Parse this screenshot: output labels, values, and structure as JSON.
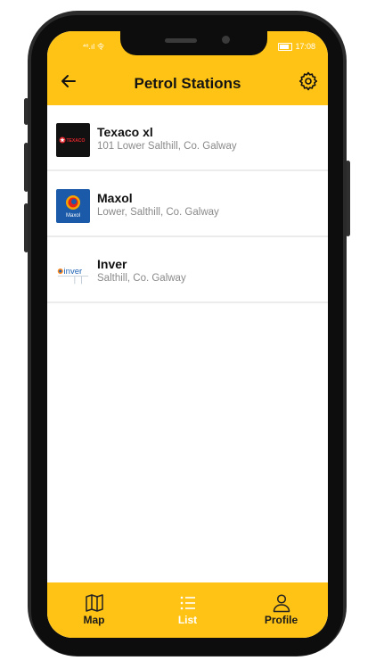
{
  "status": {
    "left": "⁴⁶.ıl 令",
    "time": "17:08"
  },
  "header": {
    "title": "Petrol Stations",
    "back_icon": "arrow-left-icon",
    "settings_icon": "gear-icon"
  },
  "stations": [
    {
      "name": "Texaco xl",
      "address": "101 Lower Salthill, Co. Galway",
      "logo": "texaco-logo",
      "logo_text": "TEXACO"
    },
    {
      "name": "Maxol",
      "address": "Lower, Salthill, Co. Galway",
      "logo": "maxol-logo",
      "logo_text": "Maxol"
    },
    {
      "name": "Inver",
      "address": "Salthill, Co. Galway",
      "logo": "inver-logo",
      "logo_text": "inver"
    }
  ],
  "nav": {
    "items": [
      {
        "label": "Map",
        "icon": "map-icon",
        "active": false
      },
      {
        "label": "List",
        "icon": "list-icon",
        "active": true
      },
      {
        "label": "Profile",
        "icon": "profile-icon",
        "active": false
      }
    ]
  },
  "colors": {
    "accent": "#FFC316",
    "active_nav": "#FFFFFF",
    "address_text": "#8A8A8A"
  }
}
